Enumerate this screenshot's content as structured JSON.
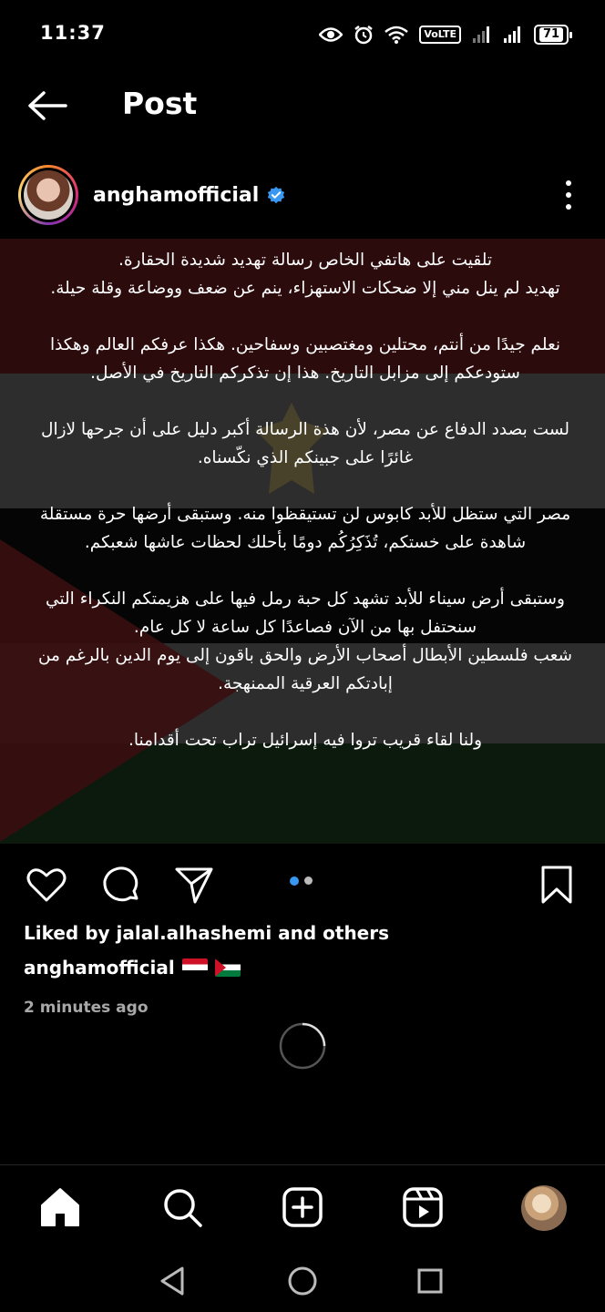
{
  "status_bar": {
    "time": "11:37",
    "volte": "VoLTE",
    "battery": "71",
    "icons": [
      "eye-icon",
      "alarm-icon",
      "wifi-icon",
      "signal-icon",
      "signal-icon",
      "battery-icon"
    ]
  },
  "header": {
    "title": "Post"
  },
  "post": {
    "username": "anghamofficial",
    "verified": true,
    "body": "تلقيت على هاتفي الخاص رسالة تهديد شديدة الحقارة.\nتهديد لم ينل مني إلا ضحكات الاستهزاء، ينم عن ضعف ووضاعة وقلة حيلة.\n\nنعلم جيدًا من أنتم، محتلين ومغتصبين وسفاحين. هكذا عرفكم العالم وهكذا ستودعكم إلى مزابل التاريخ. هذا إن تذكركم التاريخ في الأصل.\n\nلست بصدد الدفاع عن مصر، لأن هذة الرسالة أكبر دليل على أن جرحها لازال غائرًا على جبينكم الذي نكّسناه.\n\nمصر التي ستظل للأبد كابوس لن تستيقظوا منه. وستبقى أرضها حرة مستقلة شاهدة على خستكم، تُذَكِرُكُم دومًا بأحلك لحظات عاشها شعبكم.\n\nوستبقى أرض سيناء للأبد تشهد كل حبة رمل فيها على هزيمتكم النكراء التي سنحتفل بها من الآن فصاعدًا كل ساعة لا كل عام.\nشعب فلسطين الأبطال أصحاب الأرض والحق باقون إلى يوم الدين بالرغم من إبادتكم العرقية الممنهجة.\n\nولنا لقاء قريب تروا فيه إسرائيل تراب تحت أقدامنا.",
    "carousel_total": 2,
    "carousel_active": 1,
    "likes_text": "Liked by jalal.alhashemi and others",
    "caption_user": "anghamofficial",
    "timestamp": "2 minutes ago"
  },
  "colors": {
    "accent_blue": "#3897f0",
    "verified_blue": "#3897f0",
    "timestamp_gray": "#a8a8a8"
  },
  "bottom_nav": [
    "home-icon",
    "search-icon",
    "create-icon",
    "reels-icon",
    "profile-avatar"
  ],
  "system_nav": [
    "back-triangle",
    "home-circle",
    "recents-square"
  ]
}
